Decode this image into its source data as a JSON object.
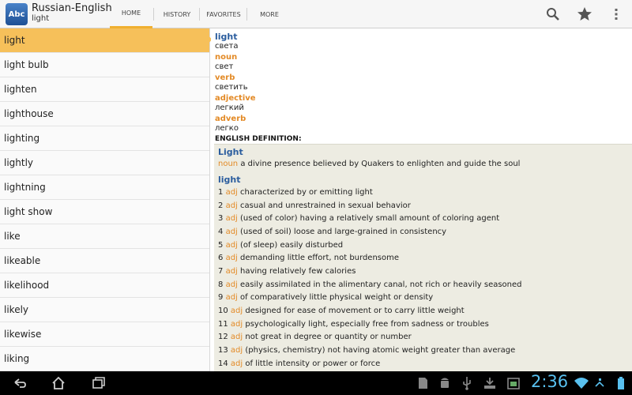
{
  "app": {
    "title": "Russian-English",
    "subtitle": "light",
    "icon_text": "Abc"
  },
  "tabs": [
    {
      "label": "HOME",
      "active": true
    },
    {
      "label": "HISTORY",
      "active": false
    },
    {
      "label": "FAVORITES",
      "active": false
    },
    {
      "label": "MORE",
      "active": false
    }
  ],
  "actions": {
    "icons": [
      "search-icon",
      "star-icon",
      "overflow-menu-icon"
    ]
  },
  "wordlist": {
    "selected": "light",
    "items": [
      "light",
      "light bulb",
      "lighten",
      "lighthouse",
      "lighting",
      "lightly",
      "lightning",
      "light show",
      "like",
      "likeable",
      "likelihood",
      "likely",
      "likewise",
      "liking"
    ]
  },
  "definition": {
    "headword": "light",
    "headword_translation": "света",
    "parts": [
      {
        "pos": "noun",
        "translation": "свет"
      },
      {
        "pos": "verb",
        "translation": "светить"
      },
      {
        "pos": "adjective",
        "translation": "легкий"
      },
      {
        "pos": "adverb",
        "translation": "легко"
      }
    ],
    "english_label": "ENGLISH DEFINITION:",
    "entry1": {
      "word": "Light",
      "pos": "noun",
      "text": "a divine presence believed by Quakers to enlighten and guide the soul"
    },
    "entry2": {
      "word": "light",
      "senses": [
        {
          "n": "1",
          "pos": "adj",
          "text": "characterized by or emitting light"
        },
        {
          "n": "2",
          "pos": "adj",
          "text": "casual and unrestrained in sexual behavior"
        },
        {
          "n": "3",
          "pos": "adj",
          "text": "(used of color) having a relatively small amount of coloring agent"
        },
        {
          "n": "4",
          "pos": "adj",
          "text": "(used of soil) loose and large-grained in consistency"
        },
        {
          "n": "5",
          "pos": "adj",
          "text": "(of sleep) easily disturbed"
        },
        {
          "n": "6",
          "pos": "adj",
          "text": "demanding little effort, not burdensome"
        },
        {
          "n": "7",
          "pos": "adj",
          "text": "having relatively few calories"
        },
        {
          "n": "8",
          "pos": "adj",
          "text": "easily assimilated in the alimentary canal, not rich or heavily seasoned"
        },
        {
          "n": "9",
          "pos": "adj",
          "text": "of comparatively little physical weight or density"
        },
        {
          "n": "10",
          "pos": "adj",
          "text": "designed for ease of movement or to carry little weight"
        },
        {
          "n": "11",
          "pos": "adj",
          "text": "psychologically light, especially free from sadness or troubles"
        },
        {
          "n": "12",
          "pos": "adj",
          "text": "not great in degree or quantity or number"
        },
        {
          "n": "13",
          "pos": "adj",
          "text": "(physics, chemistry) not having atomic weight greater than average"
        },
        {
          "n": "14",
          "pos": "adj",
          "text": "of little intensity or power or force"
        }
      ]
    }
  },
  "statusbar": {
    "time": "2:36",
    "accent": "#59c1f0",
    "nav_icons": [
      "back-icon",
      "home-icon",
      "recent-apps-icon"
    ],
    "notification_icons": [
      "sd-card-icon",
      "android-debug-icon",
      "usb-icon",
      "download-icon",
      "screenshot-icon",
      "wifi-icon",
      "battery-icon"
    ]
  }
}
